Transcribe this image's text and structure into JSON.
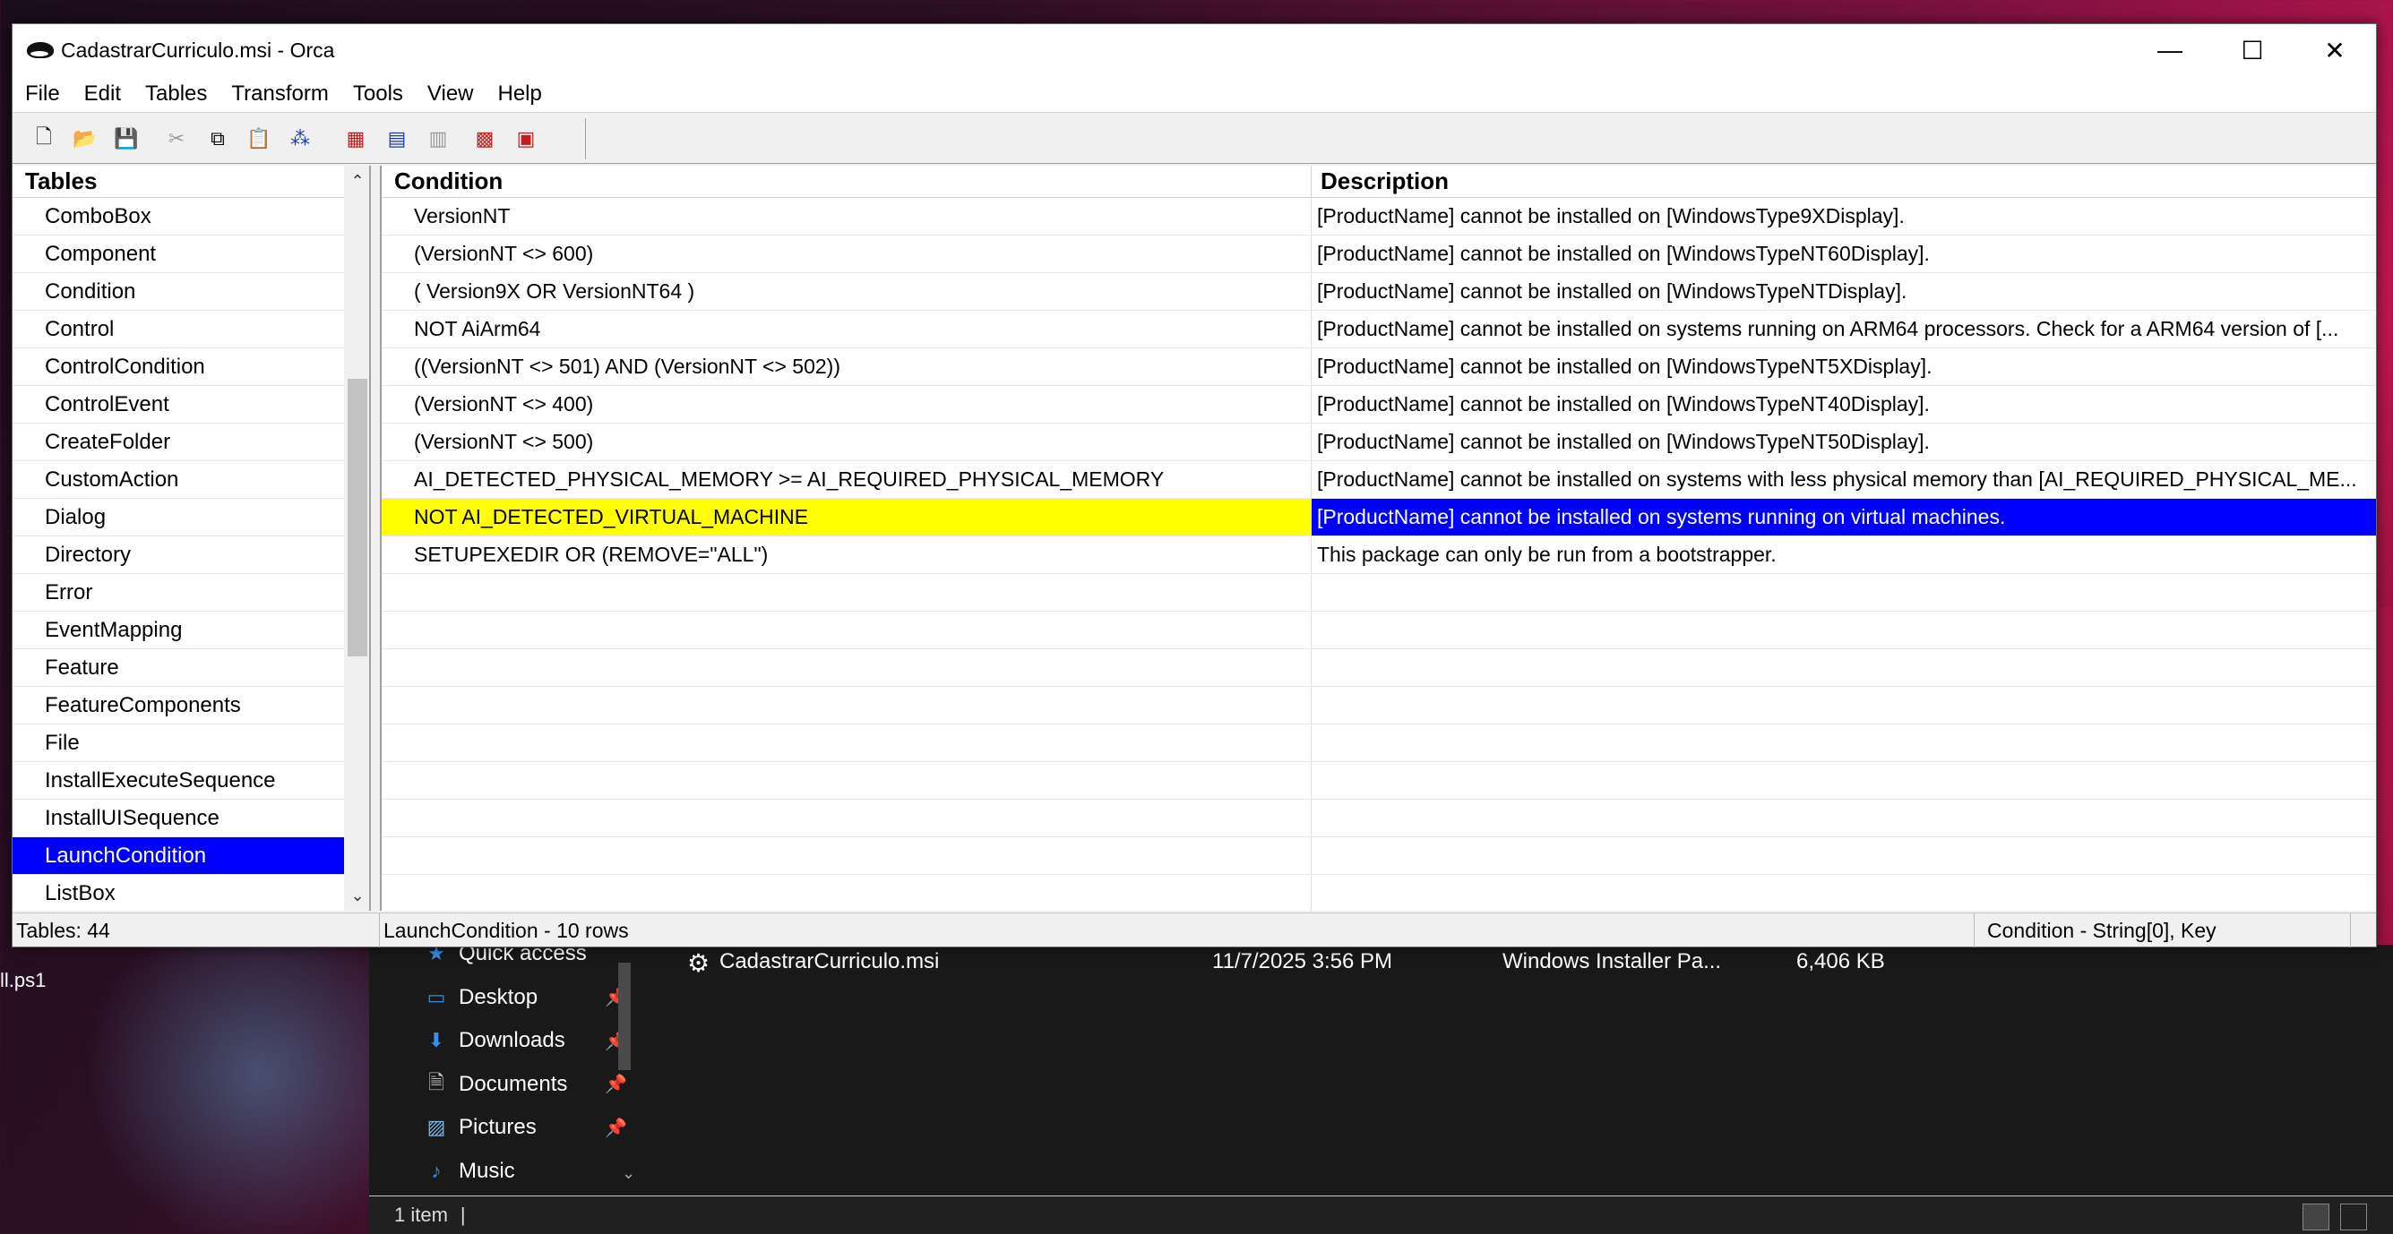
{
  "window": {
    "title": "CadastrarCurriculo.msi - Orca"
  },
  "window_controls": {
    "minimize": "—",
    "maximize": "☐",
    "close": "✕"
  },
  "menu": [
    "File",
    "Edit",
    "Tables",
    "Transform",
    "Tools",
    "View",
    "Help"
  ],
  "tables_pane": {
    "header": "Tables",
    "items": [
      "ComboBox",
      "Component",
      "Condition",
      "Control",
      "ControlCondition",
      "ControlEvent",
      "CreateFolder",
      "CustomAction",
      "Dialog",
      "Directory",
      "Error",
      "EventMapping",
      "Feature",
      "FeatureComponents",
      "File",
      "InstallExecuteSequence",
      "InstallUISequence",
      "LaunchCondition",
      "ListBox"
    ],
    "selected": "LaunchCondition"
  },
  "grid": {
    "columns": [
      "Condition",
      "Description"
    ],
    "rows": [
      {
        "condition": "VersionNT",
        "description": "[ProductName] cannot be installed on [WindowsType9XDisplay]."
      },
      {
        "condition": "(VersionNT <> 600)",
        "description": "[ProductName] cannot be installed on [WindowsTypeNT60Display]."
      },
      {
        "condition": "( Version9X OR VersionNT64 )",
        "description": "[ProductName] cannot be installed on [WindowsTypeNTDisplay]."
      },
      {
        "condition": "NOT AiArm64",
        "description": "[ProductName] cannot be installed on systems running on ARM64 processors. Check for a ARM64 version of [..."
      },
      {
        "condition": "((VersionNT <> 501) AND (VersionNT <> 502))",
        "description": "[ProductName] cannot be installed on [WindowsTypeNT5XDisplay]."
      },
      {
        "condition": "(VersionNT <> 400)",
        "description": "[ProductName] cannot be installed on [WindowsTypeNT40Display]."
      },
      {
        "condition": "(VersionNT <> 500)",
        "description": "[ProductName] cannot be installed on [WindowsTypeNT50Display]."
      },
      {
        "condition": "AI_DETECTED_PHYSICAL_MEMORY >= AI_REQUIRED_PHYSICAL_MEMORY",
        "description": "[ProductName] cannot be installed on systems with less physical memory than [AI_REQUIRED_PHYSICAL_ME..."
      },
      {
        "condition": "NOT AI_DETECTED_VIRTUAL_MACHINE",
        "description": "[ProductName] cannot be installed on systems running on virtual machines."
      },
      {
        "condition": "SETUPEXEDIR OR (REMOVE=\"ALL\")",
        "description": "This package can only be run from a bootstrapper."
      }
    ],
    "highlighted_row_index": 8
  },
  "statusbar": {
    "tables_count": "Tables: 44",
    "table_info": "LaunchCondition - 10 rows",
    "column_info": "Condition - String[0], Key"
  },
  "explorer": {
    "nav": [
      {
        "label": "Quick access",
        "icon": "star-icon",
        "pinned": false
      },
      {
        "label": "Desktop",
        "icon": "desktop-icon",
        "pinned": true
      },
      {
        "label": "Downloads",
        "icon": "download-icon",
        "pinned": true
      },
      {
        "label": "Documents",
        "icon": "document-icon",
        "pinned": true
      },
      {
        "label": "Pictures",
        "icon": "pictures-icon",
        "pinned": true
      },
      {
        "label": "Music",
        "icon": "music-icon",
        "pinned": false
      }
    ],
    "file": {
      "name": "CadastrarCurriculo.msi",
      "date": "11/7/2025 3:56 PM",
      "type": "Windows Installer Pa...",
      "size": "6,406 KB"
    },
    "status": "1 item"
  },
  "desktop": {
    "partial_label": "ll.ps1"
  },
  "colors": {
    "selection_blue": "#0000ff",
    "highlight_yellow": "#ffff00",
    "explorer_bg": "#191919"
  }
}
